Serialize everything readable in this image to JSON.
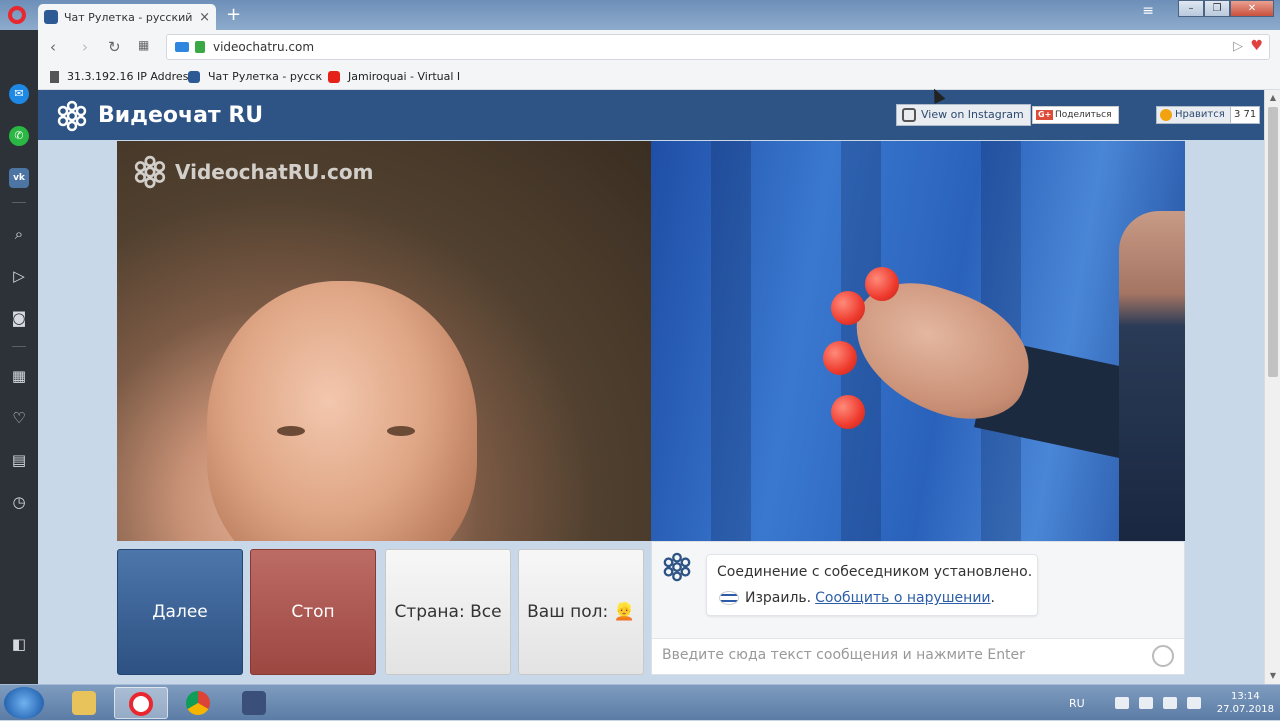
{
  "browser": {
    "tab_title": "Чат Рулетка - русский ви",
    "tab_close": "×",
    "new_tab": "+",
    "url": "videochatru.com",
    "menu_icon": "≡",
    "win_min": "–",
    "win_max": "❐",
    "win_close": "✕",
    "nav_back": "‹",
    "nav_forward": "›",
    "nav_reload": "↻",
    "nav_tabs": "▦"
  },
  "bookmarks": [
    {
      "label": "31.3.192.16 IP Addres",
      "icon": "page-icon"
    },
    {
      "label": "Чат Рулетка - русск",
      "icon": "site-logo-icon"
    },
    {
      "label": "Jamiroquai - Virtual I",
      "icon": "youtube-icon"
    }
  ],
  "site": {
    "title": "Видеочат RU",
    "instagram_label": "View on Instagram",
    "share_label": "Поделиться",
    "share_gplus": "G+",
    "like_label": "Нравится",
    "like_count": "3 71",
    "watermark": "VideochatRU.com"
  },
  "controls": {
    "next_label": "Далее",
    "stop_label": "Стоп",
    "country_label": "Страна: Все",
    "gender_label": "Ваш пол: 👱"
  },
  "chat": {
    "status_message": "Соединение с собеседником установлено.",
    "country": "Израиль.",
    "report_link": "Сообщить о нарушении",
    "report_suffix": ".",
    "input_placeholder": "Введите сюда текст сообщения и нажмите Enter"
  },
  "taskbar": {
    "language": "RU",
    "time": "13:14",
    "date": "27.07.2018"
  },
  "colors": {
    "site_header": "#2d5485",
    "next_button": "#3b6396",
    "stop_button": "#ad5852",
    "opera_red": "#e8272f"
  }
}
